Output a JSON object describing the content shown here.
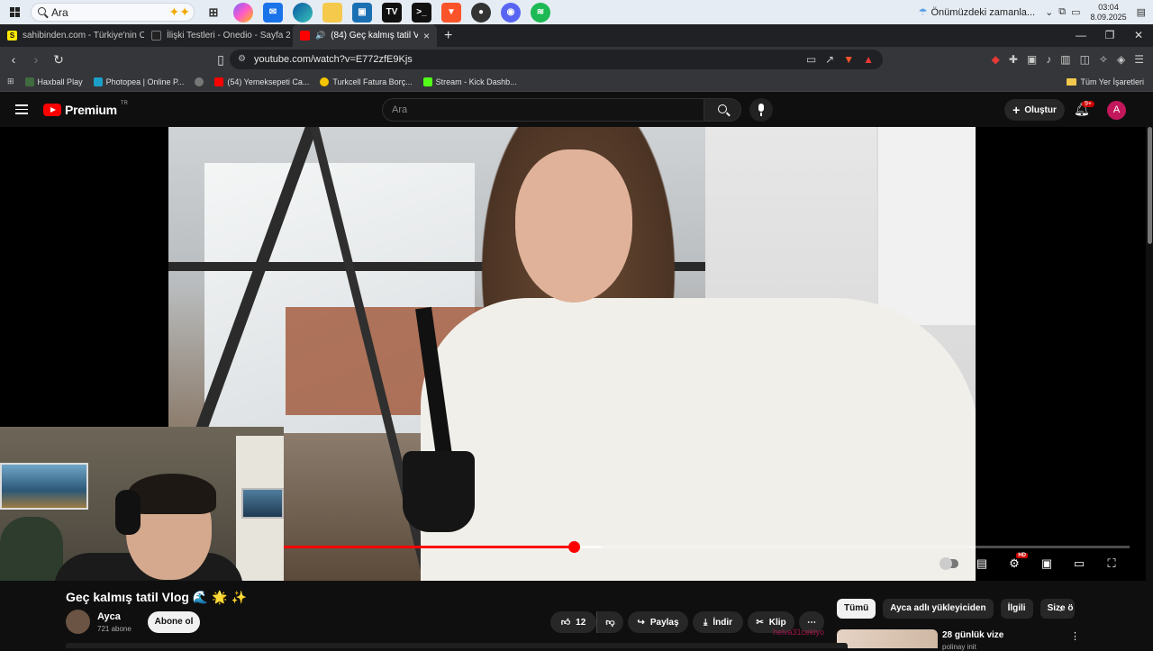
{
  "taskbar": {
    "search_placeholder": "Ara",
    "weather_text": "Önümüzdeki zamanla...",
    "time": "03:04",
    "date": "8.09.2025"
  },
  "tabs": [
    {
      "label": "sahibinden.com - Türkiye'nin Online",
      "fav_color": "#ffe800",
      "fav_text": "S"
    },
    {
      "label": "İlişki Testleri - Onedio - Sayfa 2",
      "fav_color": "#222222",
      "fav_text": ""
    },
    {
      "label": "(84) Geç kalmış tatil Vlog 🌊 (",
      "fav_color": "#ff0000",
      "fav_text": ""
    }
  ],
  "address": {
    "url": "youtube.com/watch?v=E772zfE9Kjs"
  },
  "bookmarks": [
    {
      "label": "Haxball Play",
      "color": "#3f6b3f"
    },
    {
      "label": "Photopea | Online P...",
      "color": "#1ca0c9"
    },
    {
      "label": "",
      "color": "#777777"
    },
    {
      "label": "(54) Yemeksepeti Ca...",
      "color": "#ff0000"
    },
    {
      "label": "Turkcell Fatura Borç...",
      "color": "#f5c400"
    },
    {
      "label": "Stream - Kick Dashb...",
      "color": "#53fc18"
    }
  ],
  "bookmarks_all": "Tüm Yer İşaretleri",
  "youtube": {
    "logo_text": "Premium",
    "logo_country": "TR",
    "search_placeholder": "Ara",
    "create_label": "Oluştur",
    "notif_count": "9+",
    "avatar_letter": "A"
  },
  "player": {
    "progress_fraction": 0.343,
    "buffer_fraction": 0.376
  },
  "video": {
    "title": "Geç kalmış tatil Vlog 🌊 🌟 ✨",
    "channel": "Ayca",
    "subscribers": "721 abone",
    "subscribe_label": "Abone ol",
    "likes": "12",
    "share_label": "Paylaş",
    "download_label": "İndir",
    "clip_label": "Klip",
    "overlay_text": "helva31cekiyo"
  },
  "chips": [
    "Tümü",
    "Ayca adlı yükleyiciden",
    "İlgili",
    "Size ö"
  ],
  "recommendation": {
    "title": "28 günlük vize",
    "channel": "polinay init"
  }
}
